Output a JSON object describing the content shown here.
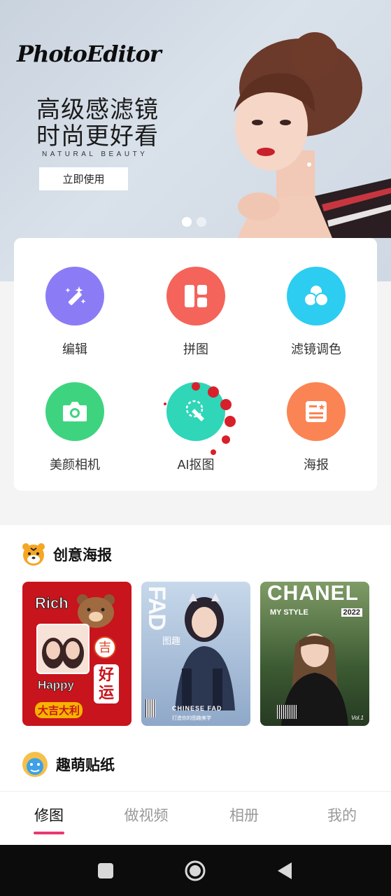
{
  "banner": {
    "logo": "PhotoEditor",
    "headline_line1": "高级感滤镜",
    "headline_line2": "时尚更好看",
    "subtitle": "NATURAL   BEAUTY",
    "cta_label": "立即使用",
    "carousel_index": 1,
    "carousel_count": 2
  },
  "tools": [
    {
      "label": "编辑",
      "icon": "magic-wand-icon",
      "color": "#8b7cf6"
    },
    {
      "label": "拼图",
      "icon": "collage-grid-icon",
      "color": "#f4645a"
    },
    {
      "label": "滤镜调色",
      "icon": "filter-circles-icon",
      "color": "#2ccdf0"
    },
    {
      "label": "美颜相机",
      "icon": "camera-icon",
      "color": "#3ed47f"
    },
    {
      "label": "AI抠图",
      "icon": "ai-cutout-icon",
      "color": "#2fd6b8"
    },
    {
      "label": "海报",
      "icon": "poster-icon",
      "color": "#fb8454"
    }
  ],
  "posters_section": {
    "title": "创意海报",
    "icon": "tiger-icon",
    "posters": [
      {
        "name": "lucky-poster",
        "top_text": "Rich",
        "mid_text": "Happy",
        "badge": "吉",
        "big_text": "好运",
        "bottom_text": "大吉大利",
        "bg": "#c8141c"
      },
      {
        "name": "fad-poster",
        "top_text": "FAD",
        "side_text": "图趣",
        "bottom_text": "CHINESE FAD",
        "caption": "打造你的图趣美学",
        "bg": "#9db7d8"
      },
      {
        "name": "chanel-poster",
        "top_text": "CHANEL",
        "sub_text": "MY STYLE",
        "year": "2022",
        "corner": "Vol.1",
        "bg": "#4a6a3a"
      }
    ]
  },
  "stickers_section": {
    "title": "趣萌贴纸",
    "icon": "cute-mascot-icon"
  },
  "tabbar": {
    "tabs": [
      "修图",
      "做视频",
      "相册",
      "我的"
    ],
    "active": "修图"
  },
  "system_nav": {
    "icons": [
      "recents-square-icon",
      "home-circle-icon",
      "back-triangle-icon"
    ]
  }
}
